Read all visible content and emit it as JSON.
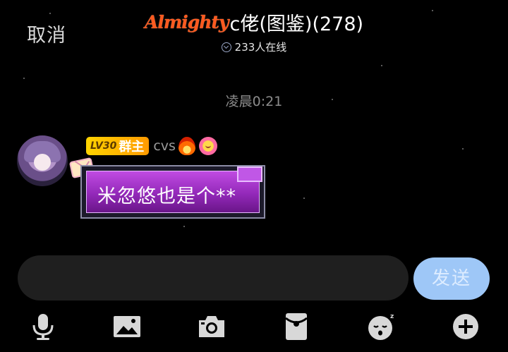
{
  "header": {
    "cancel_label": "取消",
    "brand": "Almighty",
    "title": "c佬(图鉴)(278)",
    "online_count": "233人在线"
  },
  "chat": {
    "timestamp": "凌晨0:21",
    "messages": [
      {
        "level": "LV30",
        "role": "群主",
        "username": "cvs",
        "text": "米忽悠也是个**"
      }
    ]
  },
  "composer": {
    "input_value": "",
    "send_label": "发送"
  },
  "toolbar": {
    "icons": [
      "microphone-icon",
      "image-icon",
      "camera-icon",
      "red-packet-icon",
      "emoji-sleepy-icon",
      "plus-icon"
    ]
  },
  "colors": {
    "brand": "#ff5a1f",
    "badge": "#ffb300",
    "bubble": "#a233c8",
    "send": "#9ec7f7"
  }
}
